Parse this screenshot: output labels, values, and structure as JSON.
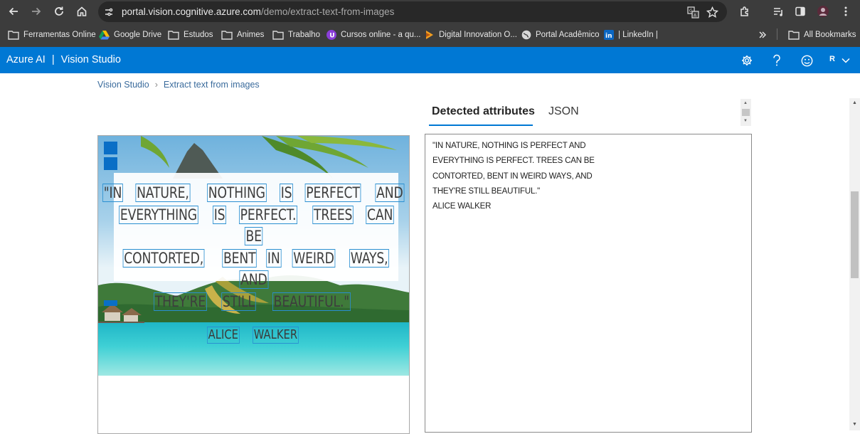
{
  "browser": {
    "url_domain": "portal.vision.cognitive.azure.com",
    "url_path": "/demo/extract-text-from-images",
    "bookmarks": [
      {
        "label": "Ferramentas Online",
        "icon": "folder-icon"
      },
      {
        "label": "Google Drive",
        "icon": "google-drive-icon"
      },
      {
        "label": "Estudos",
        "icon": "folder-icon"
      },
      {
        "label": "Animes",
        "icon": "folder-icon"
      },
      {
        "label": "Trabalho",
        "icon": "folder-icon"
      },
      {
        "label": "Cursos online - a qu...",
        "icon": "cursos-icon"
      },
      {
        "label": "Digital Innovation O...",
        "icon": "dio-icon"
      },
      {
        "label": "Portal Acadêmico",
        "icon": "globe-icon"
      },
      {
        "label": "| LinkedIn |",
        "icon": "linkedin-icon"
      }
    ],
    "all_bookmarks_label": "All Bookmarks"
  },
  "app": {
    "brand": "Azure AI",
    "separator": "|",
    "product": "Vision Studio",
    "user_initial": "R",
    "accent_color": "#0078d4"
  },
  "breadcrumb": {
    "items": [
      "Vision Studio",
      "Extract text from images"
    ],
    "separator": "›"
  },
  "tabs": [
    {
      "label": "Detected attributes",
      "active": true
    },
    {
      "label": "JSON",
      "active": false
    }
  ],
  "image": {
    "quote_lines": [
      [
        "\"IN",
        "NATURE,",
        "NOTHING",
        "IS",
        "PERFECT",
        "AND"
      ],
      [
        "EVERYTHING",
        "IS",
        "PERFECT.",
        "TREES",
        "CAN",
        "BE"
      ],
      [
        "CONTORTED,",
        "BENT",
        "IN",
        "WEIRD",
        "WAYS,",
        "AND"
      ],
      [
        "THEY'RE",
        "STILL",
        "BEAUTIFUL.\""
      ]
    ],
    "author_words": [
      "ALICE",
      "WALKER"
    ]
  },
  "results": {
    "lines": [
      "\"IN NATURE, NOTHING IS PERFECT AND",
      "EVERYTHING IS PERFECT. TREES CAN BE",
      "CONTORTED, BENT IN WEIRD WAYS, AND",
      "THEY'RE STILL BEAUTIFUL.\"",
      "ALICE WALKER"
    ]
  }
}
